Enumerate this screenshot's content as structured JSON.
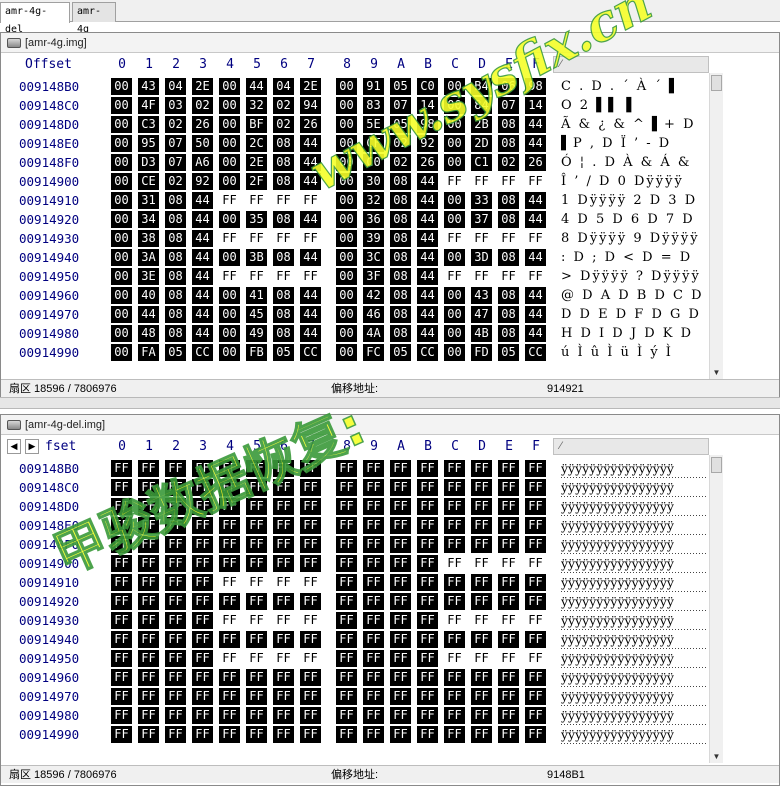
{
  "tabs": [
    "amr-4g-del",
    "amr-4g"
  ],
  "top_panel": {
    "title": "[amr-4g.img]",
    "header_offset": "Offset",
    "columns": [
      "0",
      "1",
      "2",
      "3",
      "4",
      "5",
      "6",
      "7",
      "8",
      "9",
      "A",
      "B",
      "C",
      "D",
      "E",
      "F"
    ],
    "rows": [
      {
        "offset": "009148B0",
        "bytes": [
          "00",
          "43",
          "04",
          "2E",
          "00",
          "44",
          "04",
          "2E",
          "00",
          "91",
          "05",
          "C0",
          "00",
          "B4",
          "06",
          "98"
        ],
        "inv": [
          1,
          1,
          1,
          1,
          1,
          1,
          1,
          1,
          1,
          1,
          1,
          1,
          1,
          1,
          1,
          1
        ],
        "ascii": "C . D . ´ À ´ ▌"
      },
      {
        "offset": "009148C0",
        "bytes": [
          "00",
          "4F",
          "03",
          "02",
          "00",
          "32",
          "02",
          "94",
          "00",
          "83",
          "07",
          "14",
          "00",
          "84",
          "07",
          "14"
        ],
        "inv": [
          1,
          1,
          1,
          1,
          1,
          1,
          1,
          1,
          1,
          1,
          1,
          1,
          1,
          1,
          1,
          1
        ],
        "ascii": "O   2 ▌▌   ▌"
      },
      {
        "offset": "009148D0",
        "bytes": [
          "00",
          "C3",
          "02",
          "26",
          "00",
          "BF",
          "02",
          "26",
          "00",
          "5E",
          "05",
          "98",
          "00",
          "2B",
          "08",
          "44"
        ],
        "inv": [
          1,
          1,
          1,
          1,
          1,
          1,
          1,
          1,
          1,
          1,
          1,
          1,
          1,
          1,
          1,
          1
        ],
        "ascii": "Ã & ¿ & ^ ▌+ D"
      },
      {
        "offset": "009148E0",
        "bytes": [
          "00",
          "95",
          "07",
          "50",
          "00",
          "2C",
          "08",
          "44",
          "00",
          "CF",
          "02",
          "92",
          "00",
          "2D",
          "08",
          "44"
        ],
        "inv": [
          1,
          1,
          1,
          1,
          1,
          1,
          1,
          1,
          1,
          1,
          1,
          1,
          1,
          1,
          1,
          1
        ],
        "ascii": "▌P , D Ï ’ - D"
      },
      {
        "offset": "009148F0",
        "bytes": [
          "00",
          "D3",
          "07",
          "A6",
          "00",
          "2E",
          "08",
          "44",
          "00",
          "C0",
          "02",
          "26",
          "00",
          "C1",
          "02",
          "26"
        ],
        "inv": [
          1,
          1,
          1,
          1,
          1,
          1,
          1,
          1,
          1,
          1,
          1,
          1,
          1,
          1,
          1,
          1
        ],
        "ascii": "Ó ¦ . D À & Á &"
      },
      {
        "offset": "00914900",
        "bytes": [
          "00",
          "CE",
          "02",
          "92",
          "00",
          "2F",
          "08",
          "44",
          "00",
          "30",
          "08",
          "44",
          "FF",
          "FF",
          "FF",
          "FF"
        ],
        "inv": [
          1,
          1,
          1,
          1,
          1,
          1,
          1,
          1,
          1,
          1,
          1,
          1,
          0,
          0,
          0,
          0
        ],
        "ascii": "Î ’ / D 0 Dÿÿÿÿ"
      },
      {
        "offset": "00914910",
        "bytes": [
          "00",
          "31",
          "08",
          "44",
          "FF",
          "FF",
          "FF",
          "FF",
          "00",
          "32",
          "08",
          "44",
          "00",
          "33",
          "08",
          "44"
        ],
        "inv": [
          1,
          1,
          1,
          1,
          0,
          0,
          0,
          0,
          1,
          1,
          1,
          1,
          1,
          1,
          1,
          1
        ],
        "ascii": "1 Dÿÿÿÿ 2 D 3 D"
      },
      {
        "offset": "00914920",
        "bytes": [
          "00",
          "34",
          "08",
          "44",
          "00",
          "35",
          "08",
          "44",
          "00",
          "36",
          "08",
          "44",
          "00",
          "37",
          "08",
          "44"
        ],
        "inv": [
          1,
          1,
          1,
          1,
          1,
          1,
          1,
          1,
          1,
          1,
          1,
          1,
          1,
          1,
          1,
          1
        ],
        "ascii": "4 D 5 D 6 D 7 D"
      },
      {
        "offset": "00914930",
        "bytes": [
          "00",
          "38",
          "08",
          "44",
          "FF",
          "FF",
          "FF",
          "FF",
          "00",
          "39",
          "08",
          "44",
          "FF",
          "FF",
          "FF",
          "FF"
        ],
        "inv": [
          1,
          1,
          1,
          1,
          0,
          0,
          0,
          0,
          1,
          1,
          1,
          1,
          0,
          0,
          0,
          0
        ],
        "ascii": "8 Dÿÿÿÿ 9 Dÿÿÿÿ"
      },
      {
        "offset": "00914940",
        "bytes": [
          "00",
          "3A",
          "08",
          "44",
          "00",
          "3B",
          "08",
          "44",
          "00",
          "3C",
          "08",
          "44",
          "00",
          "3D",
          "08",
          "44"
        ],
        "inv": [
          1,
          1,
          1,
          1,
          1,
          1,
          1,
          1,
          1,
          1,
          1,
          1,
          1,
          1,
          1,
          1
        ],
        "ascii": ": D ; D < D = D"
      },
      {
        "offset": "00914950",
        "bytes": [
          "00",
          "3E",
          "08",
          "44",
          "FF",
          "FF",
          "FF",
          "FF",
          "00",
          "3F",
          "08",
          "44",
          "FF",
          "FF",
          "FF",
          "FF"
        ],
        "inv": [
          1,
          1,
          1,
          1,
          0,
          0,
          0,
          0,
          1,
          1,
          1,
          1,
          0,
          0,
          0,
          0
        ],
        "ascii": "> Dÿÿÿÿ ? Dÿÿÿÿ"
      },
      {
        "offset": "00914960",
        "bytes": [
          "00",
          "40",
          "08",
          "44",
          "00",
          "41",
          "08",
          "44",
          "00",
          "42",
          "08",
          "44",
          "00",
          "43",
          "08",
          "44"
        ],
        "inv": [
          1,
          1,
          1,
          1,
          1,
          1,
          1,
          1,
          1,
          1,
          1,
          1,
          1,
          1,
          1,
          1
        ],
        "ascii": "@ D A D B D C D"
      },
      {
        "offset": "00914970",
        "bytes": [
          "00",
          "44",
          "08",
          "44",
          "00",
          "45",
          "08",
          "44",
          "00",
          "46",
          "08",
          "44",
          "00",
          "47",
          "08",
          "44"
        ],
        "inv": [
          1,
          1,
          1,
          1,
          1,
          1,
          1,
          1,
          1,
          1,
          1,
          1,
          1,
          1,
          1,
          1
        ],
        "ascii": "D D E D F D G D"
      },
      {
        "offset": "00914980",
        "bytes": [
          "00",
          "48",
          "08",
          "44",
          "00",
          "49",
          "08",
          "44",
          "00",
          "4A",
          "08",
          "44",
          "00",
          "4B",
          "08",
          "44"
        ],
        "inv": [
          1,
          1,
          1,
          1,
          1,
          1,
          1,
          1,
          1,
          1,
          1,
          1,
          1,
          1,
          1,
          1
        ],
        "ascii": "H D I D J D K D"
      },
      {
        "offset": "00914990",
        "bytes": [
          "00",
          "FA",
          "05",
          "CC",
          "00",
          "FB",
          "05",
          "CC",
          "00",
          "FC",
          "05",
          "CC",
          "00",
          "FD",
          "05",
          "CC"
        ],
        "inv": [
          1,
          1,
          1,
          1,
          1,
          1,
          1,
          1,
          1,
          1,
          1,
          1,
          1,
          1,
          1,
          1
        ],
        "ascii": "ú Ì û Ì ü Ì ý Ì"
      }
    ],
    "status": {
      "sector": "扇区 18596 / 7806976",
      "offset_label": "偏移地址:",
      "offset_value": "914921"
    }
  },
  "bottom_panel": {
    "title": "[amr-4g-del.img]",
    "header_offset": "fset",
    "columns": [
      "0",
      "1",
      "2",
      "3",
      "4",
      "5",
      "6",
      "7",
      "8",
      "9",
      "A",
      "B",
      "C",
      "D",
      "E",
      "F"
    ],
    "rows": [
      {
        "offset": "009148B0",
        "inv_pattern": "all"
      },
      {
        "offset": "009148C0",
        "inv_pattern": "all"
      },
      {
        "offset": "009148D0",
        "inv_pattern": "all"
      },
      {
        "offset": "009148E0",
        "inv_pattern": "all"
      },
      {
        "offset": "009148F0",
        "inv_pattern": "all"
      },
      {
        "offset": "00914900",
        "inv_pattern": "last4plain"
      },
      {
        "offset": "00914910",
        "inv_pattern": "mid4plain"
      },
      {
        "offset": "00914920",
        "inv_pattern": "all"
      },
      {
        "offset": "00914930",
        "inv_pattern": "split"
      },
      {
        "offset": "00914940",
        "inv_pattern": "all"
      },
      {
        "offset": "00914950",
        "inv_pattern": "split"
      },
      {
        "offset": "00914960",
        "inv_pattern": "all"
      },
      {
        "offset": "00914970",
        "inv_pattern": "all"
      },
      {
        "offset": "00914980",
        "inv_pattern": "all"
      },
      {
        "offset": "00914990",
        "inv_pattern": "all"
      }
    ],
    "byte_value": "FF",
    "ascii_line": "ÿÿÿÿÿÿÿÿÿÿÿÿÿÿÿÿ",
    "status": {
      "sector": "扇区 18596 / 7806976",
      "offset_label": "偏移地址:",
      "offset_value": "9148B1"
    }
  },
  "watermark": {
    "url": "www.sysfix.cn",
    "cn": "甲骏数据恢复:"
  },
  "colors": {
    "offset_text": "#000080",
    "inverse_bg": "#000000",
    "watermark_fill": "#f6ff2a",
    "watermark_stroke": "#3a9a3a"
  }
}
